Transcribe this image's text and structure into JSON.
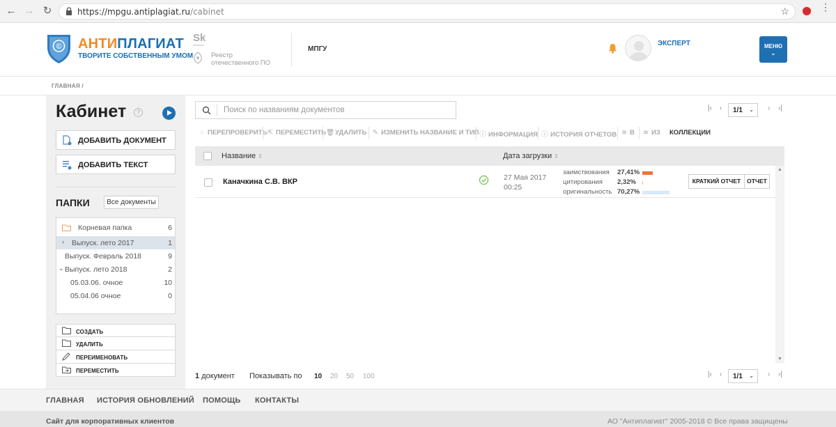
{
  "browser": {
    "url_host": "https://mpgu.antiplagiat.ru",
    "url_path": "/cabinet"
  },
  "header": {
    "logo_part1": "АНТИ",
    "logo_part2": "ПЛАГИАТ",
    "tagline": "ТВОРИТЕ СОБСТВЕННЫМ УМОМ",
    "sk_mark": "Sk",
    "sk_sub": "Skolkovo",
    "registry_line1": "Реестр",
    "registry_line2": "отечественного ПО",
    "org": "МПГУ",
    "role": "ЭКСПЕРТ",
    "menu_label": "МЕНЮ",
    "menu_chevron": "⌄"
  },
  "breadcrumb": "ГЛАВНАЯ  /",
  "sidebar": {
    "title": "Кабинет",
    "help": "?",
    "add_document": "ДОБАВИТЬ ДОКУМЕНТ",
    "add_text": "ДОБАВИТЬ ТЕКСТ",
    "folders_title": "ПАПКИ",
    "all_documents": "Все документы",
    "tree": [
      {
        "name": "Корневая папка",
        "count": "6"
      },
      {
        "name": "Выпуск. лето 2017",
        "count": "1"
      },
      {
        "name": "Выпуск. Февраль 2018",
        "count": "9"
      },
      {
        "name": "Выпуск. лето 2018",
        "count": "2"
      },
      {
        "name": "05.03.06. очное",
        "count": "10"
      },
      {
        "name": "05.04.06 очное",
        "count": "0"
      }
    ],
    "actions": {
      "create": "СОЗДАТЬ",
      "delete": "УДАЛИТЬ",
      "rename": "ПЕРЕИМЕНОВАТЬ",
      "move": "ПЕРЕМЕСТИТЬ"
    }
  },
  "main": {
    "search_placeholder": "Поиск по названиям документов",
    "pager_value": "1/1",
    "toolbar": {
      "recheck": "ПЕРЕПРОВЕРИТЬ",
      "move": "ПЕРЕМЕСТИТЬ",
      "delete": "УДАЛИТЬ",
      "rename": "ИЗМЕНИТЬ НАЗВАНИЕ И ТИП",
      "info": "ИНФОРМАЦИЯ",
      "history": "ИСТОРИЯ ОТЧЕТОВ",
      "to": "В",
      "from": "ИЗ",
      "collections": "КОЛЛЕКЦИИ"
    },
    "columns": {
      "name": "Название",
      "date": "Дата загрузки"
    },
    "rows": [
      {
        "name": "Каначкина С.В. ВКР",
        "date": "27 Мая 2017",
        "time": "00:25",
        "borrowing_label": "заимствования",
        "borrowing": "27,41%",
        "borrowing_frac": 0.2741,
        "citation_label": "цитирования",
        "citation": "2,32%",
        "citation_frac": 0.0232,
        "originality_label": "оригинальность",
        "originality": "70,27%",
        "originality_frac": 0.7027,
        "short_report": "КРАТКИЙ ОТЧЕТ",
        "report": "ОТЧЕТ"
      }
    ],
    "doc_count_num": "1",
    "doc_count_word": "документ",
    "show_by": "Показывать по",
    "page_sizes": [
      "10",
      "20",
      "50",
      "100"
    ],
    "page_size_selected": "10"
  },
  "footer": {
    "nav": [
      "ГЛАВНАЯ",
      "ИСТОРИЯ ОБНОВЛЕНИЙ",
      "ПОМОЩЬ",
      "КОНТАКТЫ"
    ],
    "left": "Сайт для корпоративных клиентов",
    "right": "АО \"Антиплагиат\" 2005-2018 © Все права защищены"
  },
  "colors": {
    "brand_blue": "#1f6fb3",
    "brand_orange": "#f08a24",
    "borrowing_bar": "#e8763a",
    "citation_bar": "#f3c84b",
    "originality_bar": "#d8e9f7"
  }
}
